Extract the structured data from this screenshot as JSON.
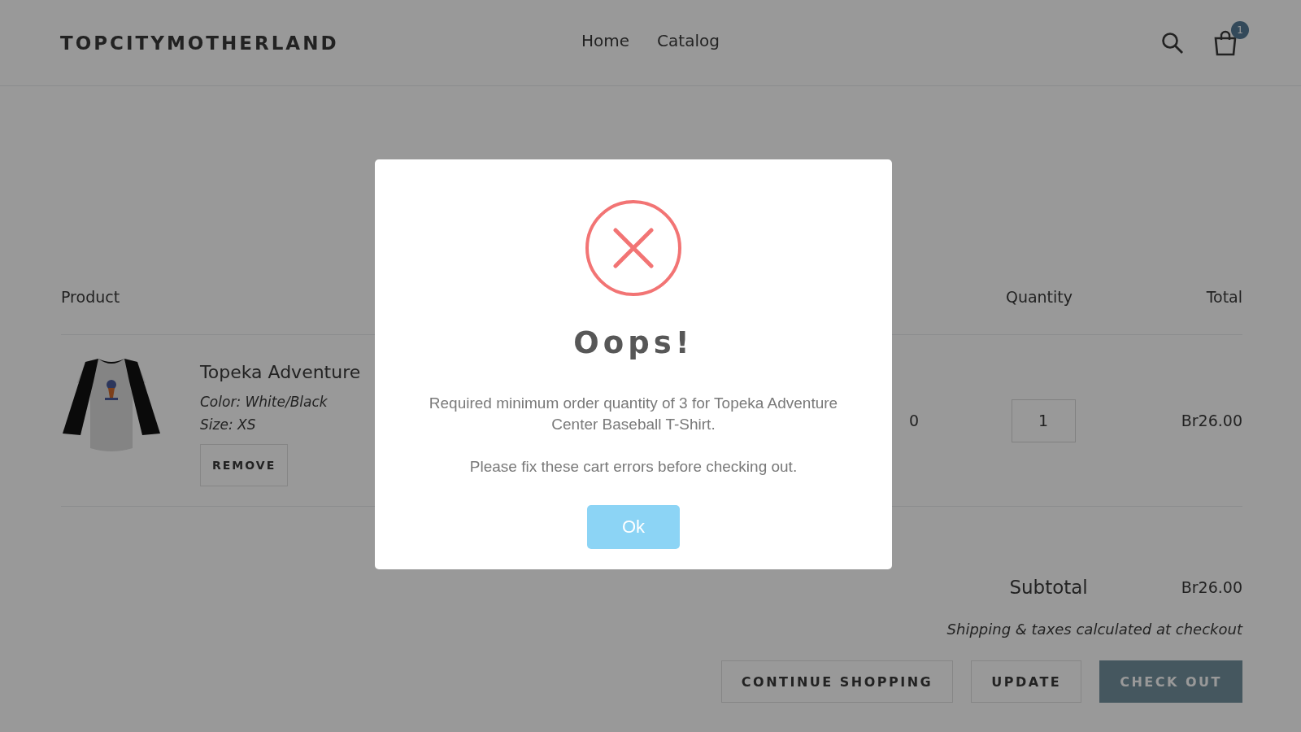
{
  "header": {
    "logo": "TOPCITYMOTHERLAND",
    "nav": [
      {
        "label": "Home"
      },
      {
        "label": "Catalog"
      }
    ],
    "cart_count": "1"
  },
  "cart": {
    "columns": {
      "product": "Product",
      "quantity": "Quantity",
      "total": "Total"
    },
    "items": [
      {
        "title": "Topeka Adventure",
        "options": [
          "Color: White/Black",
          "Size: XS"
        ],
        "remove": "REMOVE",
        "price": "0",
        "quantity": "1",
        "total": "Br26.00"
      }
    ],
    "subtotal_label": "Subtotal",
    "subtotal": "Br26.00",
    "note": "Shipping & taxes calculated at checkout",
    "buttons": [
      {
        "label": "CONTINUE SHOPPING",
        "kind": "secondary"
      },
      {
        "label": "UPDATE",
        "kind": "secondary"
      },
      {
        "label": "CHECK OUT",
        "kind": "primary"
      }
    ]
  },
  "modal": {
    "kind": "error",
    "title": "Oops!",
    "messages": [
      "Required minimum order quantity of 3 for Topeka Adventure Center Baseball T-Shirt.",
      "Please fix these cart errors before checking out."
    ],
    "button": "Ok"
  }
}
